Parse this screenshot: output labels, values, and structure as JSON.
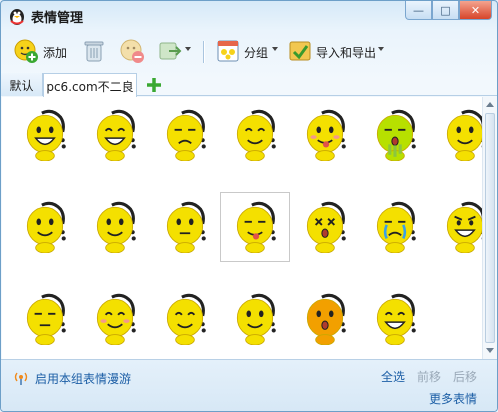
{
  "window": {
    "title": "表情管理"
  },
  "title_buttons": {
    "minimize": "—",
    "maximize": "□",
    "close": "✕"
  },
  "toolbar": {
    "add_label": "添加",
    "group_label": "分组",
    "import_export_label": "导入和导出"
  },
  "tabs": [
    {
      "label": "默认",
      "active": false
    },
    {
      "label": "pc6.com不二良",
      "active": true
    }
  ],
  "emoticons": [
    {
      "name": "grin-hand",
      "color": "#f4e000"
    },
    {
      "name": "laugh",
      "color": "#f4e000"
    },
    {
      "name": "frown",
      "color": "#f4e000"
    },
    {
      "name": "smirk",
      "color": "#f4e000"
    },
    {
      "name": "happy",
      "color": "#f4e000"
    },
    {
      "name": "sick",
      "color": "#b7e000"
    },
    {
      "name": "smile",
      "color": "#f4e000"
    },
    {
      "name": "smile",
      "color": "#f4e000"
    },
    {
      "name": "smile",
      "color": "#f4e000"
    },
    {
      "name": "think",
      "color": "#f4e000"
    },
    {
      "name": "tongue",
      "color": "#f4e000"
    },
    {
      "name": "dizzy",
      "color": "#f4e000"
    },
    {
      "name": "cry",
      "color": "#f4e000"
    },
    {
      "name": "angry",
      "color": "#f4e000"
    },
    {
      "name": "sleepy",
      "color": "#f4e000"
    },
    {
      "name": "shy",
      "color": "#f4e000"
    },
    {
      "name": "hug",
      "color": "#f4e000"
    },
    {
      "name": "point",
      "color": "#f4e000"
    },
    {
      "name": "scared",
      "color": "#f2a000"
    },
    {
      "name": "grin-teeth",
      "color": "#f4e000"
    }
  ],
  "footer": {
    "roam_label": "启用本组表情漫游",
    "select_all": "全选",
    "move_forward": "前移",
    "move_back": "后移",
    "more_emotions": "更多表情"
  },
  "colors": {
    "link": "#1d5fa6",
    "disabled": "#9aa9b8",
    "face_yellow": "#f4e000"
  }
}
